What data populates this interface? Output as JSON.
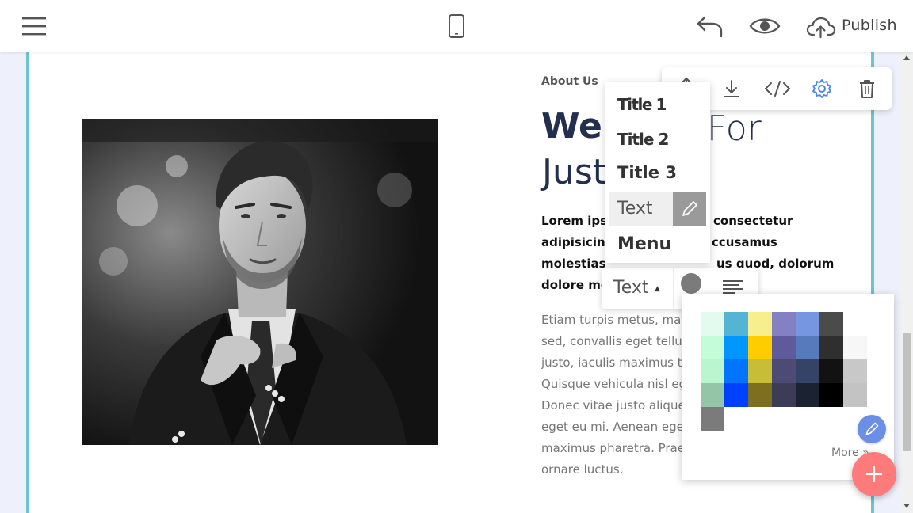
{
  "topbar": {
    "publish_label": "Publish"
  },
  "content": {
    "about_label": "About Us",
    "heading_bold": "We",
    "heading_light": "For",
    "heading_line2": "Just",
    "bold_paragraph": [
      {
        "left": "Lorem ipsu",
        "right": "consectetur"
      },
      {
        "left": "adipisicing",
        "right": "ccusamus"
      },
      {
        "left": "molestias",
        "right": "us quod, dolorum"
      },
      {
        "left": "dolore mo",
        "right": ""
      }
    ],
    "grey_paragraph": [
      "Etiam turpis metus, mat",
      "sed, convallis eget tellus",
      "justo, iaculis maximus to",
      "Quisque vehicula nisl eg",
      "Donec vitae justo alique",
      "eget eu mi. Aenean eget",
      "maximus pharetra. Prae",
      "ornare luctus."
    ]
  },
  "style_menu": {
    "items": [
      "Title 1",
      "Title 2",
      "Title 3",
      "Text",
      "Menu"
    ],
    "selected": "Text"
  },
  "text_toolbar": {
    "style_label": "Text",
    "caret": "▲"
  },
  "color_panel": {
    "more_label": "More »",
    "rows": [
      [
        "#e2fbee",
        "#55b4d6",
        "#f7ef8e",
        "#8381c3",
        "#7796e1",
        "#4b4b4b",
        ""
      ],
      [
        "#c4fcd9",
        "#0096ff",
        "#ffcc00",
        "#5f5a9a",
        "#567abb",
        "#2f2f2f",
        "#f7f7f7"
      ],
      [
        "#b9f5cf",
        "#0075fb",
        "#c8bd36",
        "#4d4b75",
        "#354466",
        "#121212",
        "#c8c8c8"
      ],
      [
        "#95c5a7",
        "#0040ff",
        "#7d6f20",
        "#3d3c57",
        "#1b2231",
        "#000000",
        "#c3c3c3"
      ],
      [
        "#7b7b7b",
        "",
        "",
        "",
        "",
        "",
        ""
      ]
    ]
  },
  "colors": {
    "accent_border": "#6cc4d0",
    "heading": "#232f4e",
    "fab": "#ff7a7a",
    "edit_button": "#6b8ee6",
    "gear": "#4a86e8"
  }
}
